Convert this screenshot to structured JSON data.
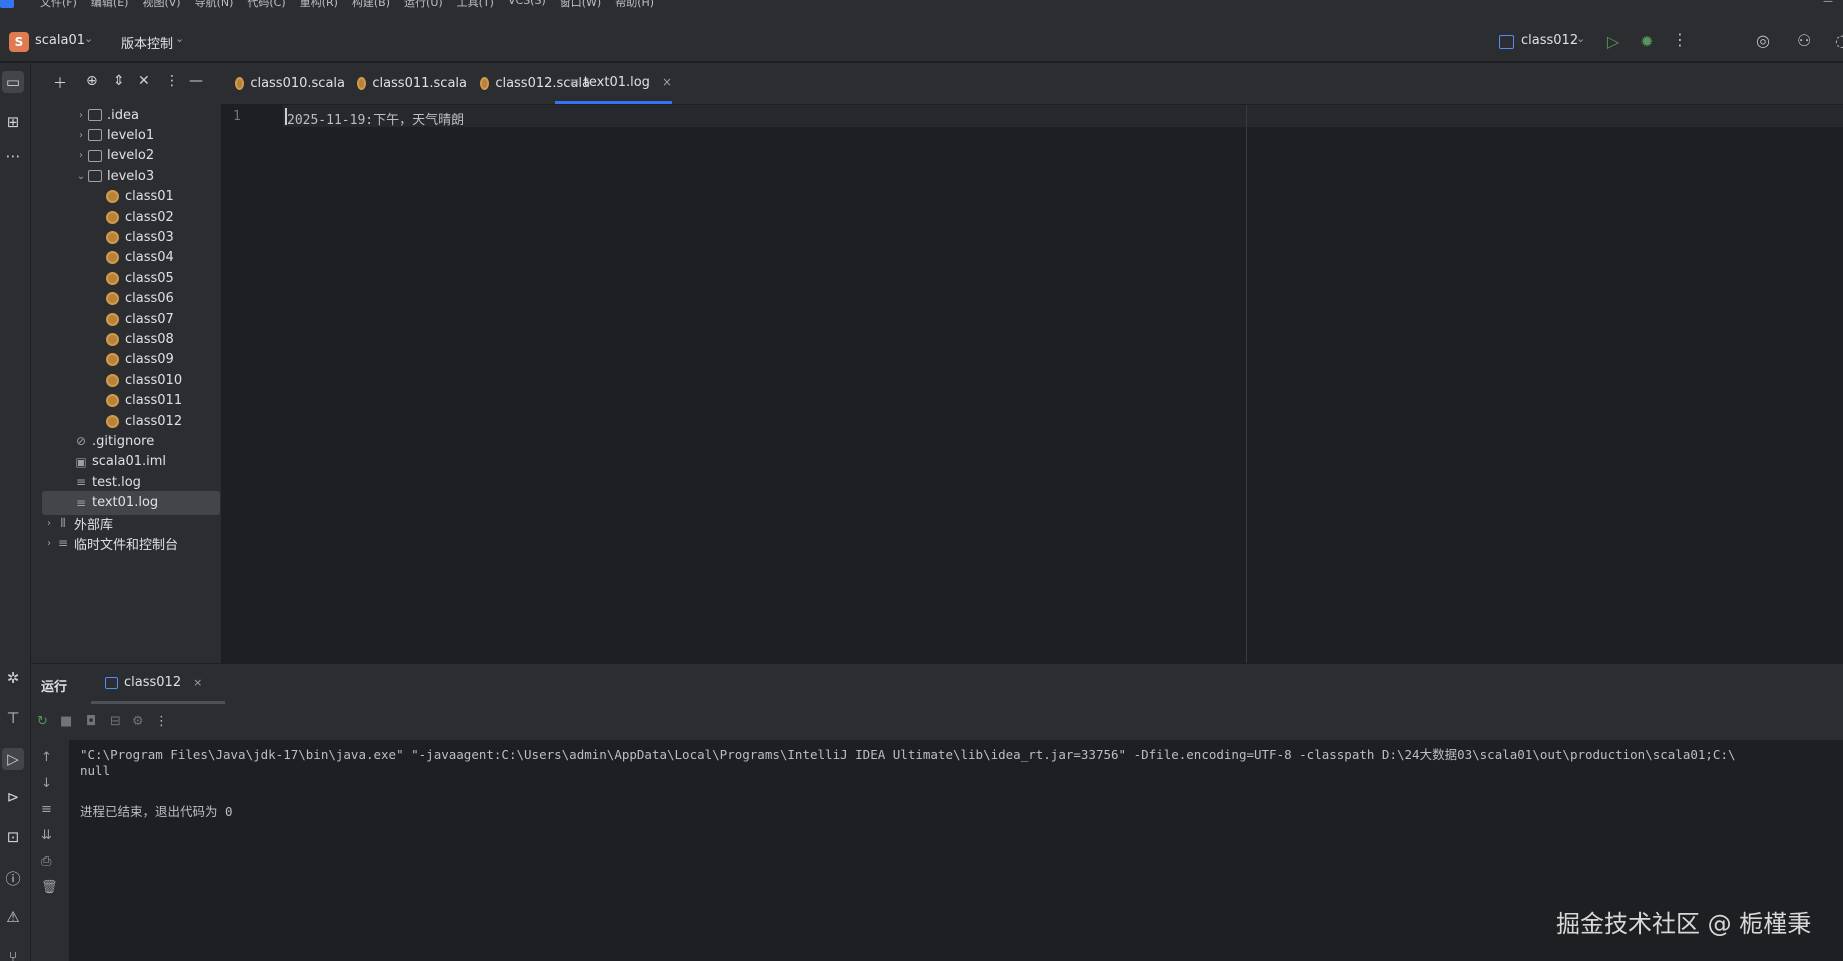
{
  "menu": {
    "items": [
      "文件(F)",
      "编辑(E)",
      "视图(V)",
      "导航(N)",
      "代码(C)",
      "重构(R)",
      "构建(B)",
      "运行(U)",
      "工具(T)",
      "VCS(S)",
      "窗口(W)",
      "帮助(H)"
    ]
  },
  "titlebar": {
    "project_badge": "S",
    "project_name": "scala01",
    "vcs_label": "版本控制",
    "run_config": "class012"
  },
  "project_tree": {
    "items": [
      {
        "label": ".idea",
        "kind": "folder",
        "expanded": false
      },
      {
        "label": "levelo1",
        "kind": "package",
        "expanded": false
      },
      {
        "label": "levelo2",
        "kind": "package",
        "expanded": false
      },
      {
        "label": "levelo3",
        "kind": "package",
        "expanded": true
      },
      {
        "label": "class01",
        "kind": "scala"
      },
      {
        "label": "class02",
        "kind": "scala"
      },
      {
        "label": "class03",
        "kind": "scala"
      },
      {
        "label": "class04",
        "kind": "scala"
      },
      {
        "label": "class05",
        "kind": "scala"
      },
      {
        "label": "class06",
        "kind": "scala"
      },
      {
        "label": "class07",
        "kind": "scala"
      },
      {
        "label": "class08",
        "kind": "scala"
      },
      {
        "label": "class09",
        "kind": "scala"
      },
      {
        "label": "class010",
        "kind": "scala"
      },
      {
        "label": "class011",
        "kind": "scala"
      },
      {
        "label": "class012",
        "kind": "scala"
      },
      {
        "label": ".gitignore",
        "kind": "ignore"
      },
      {
        "label": "scala01.iml",
        "kind": "iml"
      },
      {
        "label": "test.log",
        "kind": "log"
      },
      {
        "label": "text01.log",
        "kind": "log",
        "selected": true
      },
      {
        "label": "外部库",
        "kind": "library",
        "expanded": false
      },
      {
        "label": "临时文件和控制台",
        "kind": "scratch",
        "expanded": false
      }
    ]
  },
  "editor": {
    "tabs": [
      {
        "label": "class010.scala",
        "icon": "scala-icon"
      },
      {
        "label": "class011.scala",
        "icon": "scala-icon"
      },
      {
        "label": "class012.scala",
        "icon": "scala-icon"
      },
      {
        "label": "text01.log",
        "icon": "text-file-icon",
        "active": true,
        "close": "×"
      }
    ],
    "line_number": "1",
    "content": "2025-11-19:下午，天气晴朗"
  },
  "run_panel": {
    "title": "运行",
    "tab_label": "class012",
    "tab_close": "×",
    "console_lines": [
      "\"C:\\Program Files\\Java\\jdk-17\\bin\\java.exe\" \"-javaagent:C:\\Users\\admin\\AppData\\Local\\Programs\\IntelliJ IDEA Ultimate\\lib\\idea_rt.jar=33756\" -Dfile.encoding=UTF-8 -classpath D:\\24大数据03\\scala01\\out\\production\\scala01;C:\\",
      "null",
      "",
      "进程已结束，退出代码为 0"
    ]
  },
  "watermark": "掘金技术社区 @ 栀槿秉",
  "colors": {
    "accent": "#3574f0",
    "scala_icon": "#b8823a",
    "run_green": "#57965c",
    "background": "#1e1f22",
    "panel": "#2b2d30"
  }
}
